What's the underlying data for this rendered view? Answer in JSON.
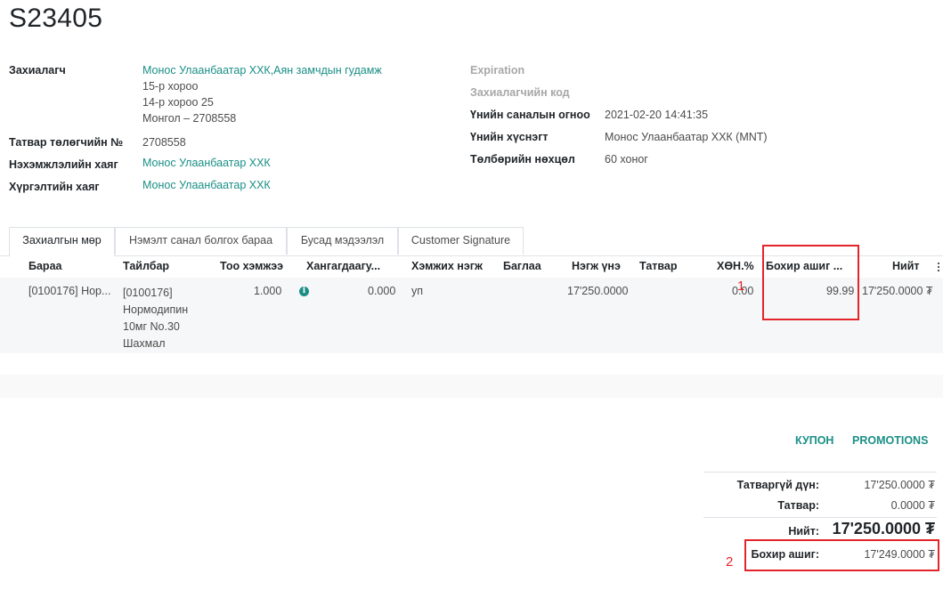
{
  "order": {
    "name": "S23405"
  },
  "customer": {
    "label": "Захиалагч",
    "name": "Монос Улаанбаатар ХХК,Аян замчдын гудамж",
    "address": [
      "15-р хороо",
      "14-р хороо 25",
      "Монгол – 2708558"
    ]
  },
  "tax_id": {
    "label": "Татвар төлөгчийн №",
    "value": "2708558"
  },
  "invoice_address": {
    "label": "Нэхэмжлэлийн хаяг",
    "value": "Монос Улаанбаатар ХХК"
  },
  "delivery_address": {
    "label": "Хүргэлтийн хаяг",
    "value": "Монос Улаанбаатар ХХК"
  },
  "right_fields": {
    "expiration": {
      "label": "Expiration",
      "value": ""
    },
    "customer_ref": {
      "label": "Захиалагчийн код",
      "value": ""
    },
    "quote_date": {
      "label": "Үнийн саналын огноо",
      "value": "2021-02-20 14:41:35"
    },
    "pricelist": {
      "label": "Үнийн хүснэгт",
      "value": "Монос Улаанбаатар ХХК (MNT)"
    },
    "payment_terms": {
      "label": "Төлбөрийн нөхцөл",
      "value": "60 хоног"
    }
  },
  "tabs": [
    "Захиалгын мөр",
    "Нэмэлт санал болгох бараа",
    "Бусад мэдээлэл",
    "Customer Signature"
  ],
  "columns": {
    "product": "Бараа",
    "description": "Тайлбар",
    "quantity": "Тоо хэмжээ",
    "delivered": "Хангагдаагу...",
    "uom": "Хэмжих нэгж",
    "package": "Баглаа",
    "unit_price": "Нэгж үнэ",
    "tax": "Татвар",
    "discount": "ХӨН.%",
    "margin": "Бохир ашиг ...",
    "subtotal": "Нийт"
  },
  "line": {
    "product": "[0100176] Нор...",
    "description": [
      "[0100176]",
      "Нормодипин",
      "10мг No.30",
      "Шахмал"
    ],
    "quantity": "1.000",
    "delivered": "0.000",
    "uom": "уп",
    "unit_price": "17'250.0000",
    "discount": "0.00",
    "margin": "99.99",
    "subtotal": "17'250.0000 ₮"
  },
  "buttons": {
    "coupon": "КУПОН",
    "promotions": "PROMOTIONS"
  },
  "totals": {
    "untaxed_label": "Татваргүй дүн:",
    "untaxed": "17'250.0000 ₮",
    "tax_label": "Татвар:",
    "tax": "0.0000 ₮",
    "total_label": "Нийт:",
    "total": "17'250.0000 ₮",
    "margin_label": "Бохир ашиг:",
    "margin": "17'249.0000 ₮"
  },
  "annotations": [
    "1",
    "2"
  ],
  "colors": {
    "accent": "#1a8f86",
    "highlight": "#e3242b"
  }
}
